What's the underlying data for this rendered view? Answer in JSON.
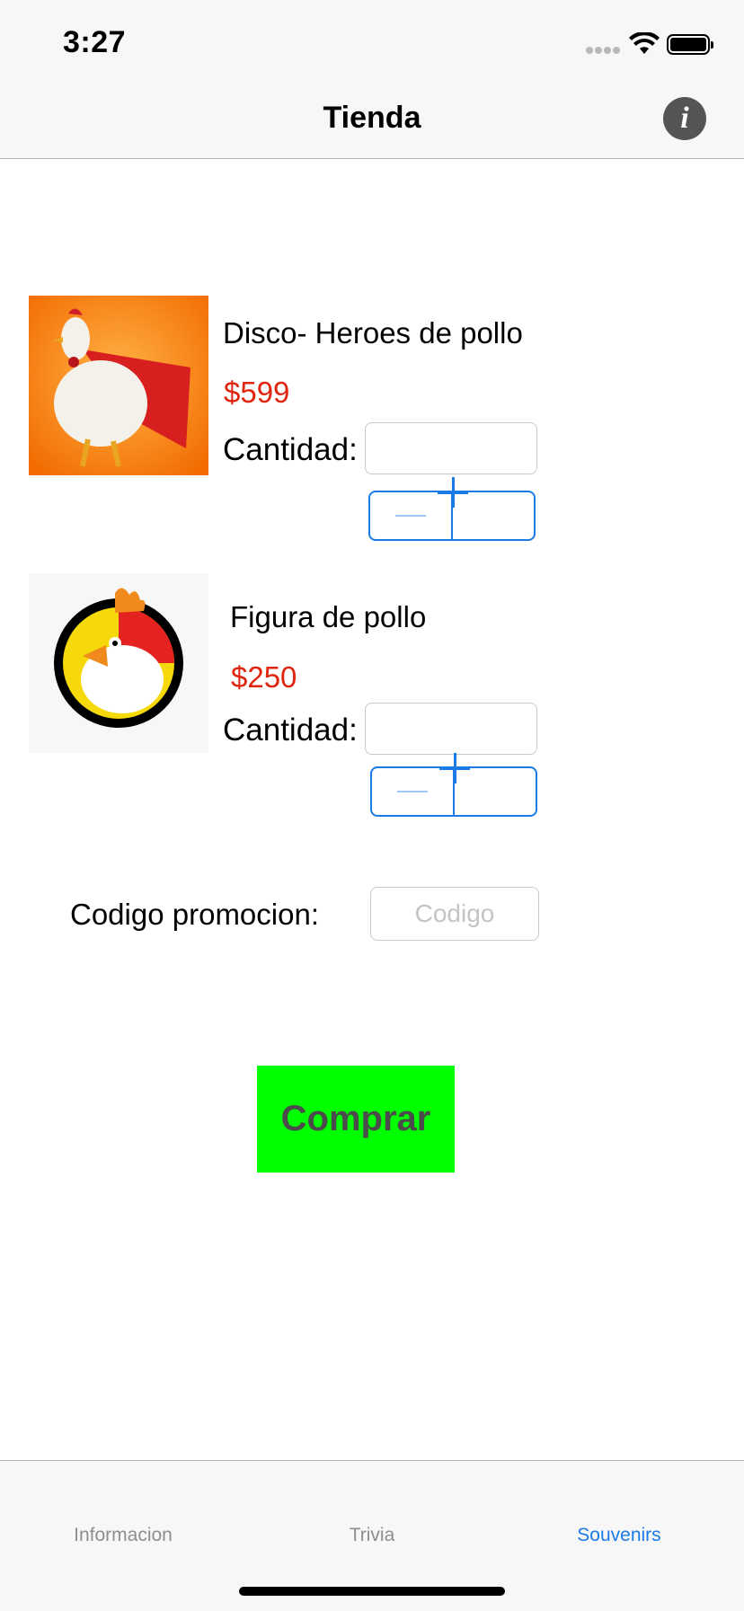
{
  "status_bar": {
    "time": "3:27"
  },
  "nav": {
    "title": "Tienda",
    "info_icon": "info-icon"
  },
  "products": [
    {
      "title": "Disco- Heroes de pollo",
      "price": "$599",
      "qty_label": "Cantidad:",
      "qty_value": "",
      "image": "superhero-chicken-image"
    },
    {
      "title": "Figura de pollo",
      "price": "$250",
      "qty_label": "Cantidad:",
      "qty_value": "",
      "image": "strong-rooster-logo-image"
    }
  ],
  "promo": {
    "label": "Codigo promocion:",
    "placeholder": "Codigo"
  },
  "buy_button": {
    "label": "Comprar"
  },
  "tabs": [
    {
      "label": "Informacion",
      "active": false
    },
    {
      "label": "Trivia",
      "active": false
    },
    {
      "label": "Souvenirs",
      "active": true
    }
  ],
  "colors": {
    "accent": "#1a7ae6",
    "price": "#e0250f",
    "buy": "#00ff00"
  }
}
